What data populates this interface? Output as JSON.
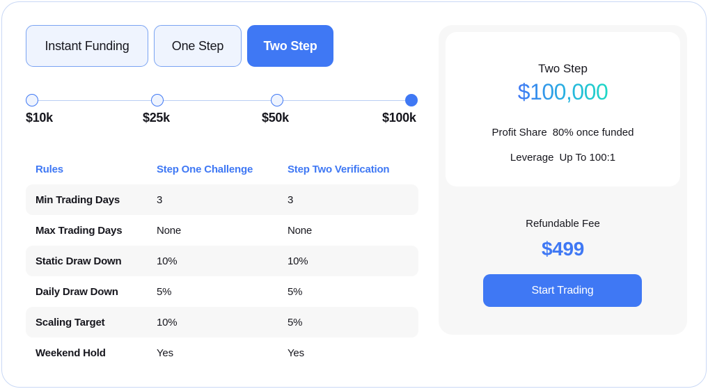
{
  "tabs": [
    {
      "label": "Instant Funding",
      "active": false
    },
    {
      "label": "One Step",
      "active": false
    },
    {
      "label": "Two Step",
      "active": true
    }
  ],
  "account_sizes": {
    "options": [
      "$10k",
      "$25k",
      "$50k",
      "$100k"
    ],
    "selected_index": 3
  },
  "rules_table": {
    "headers": [
      "Rules",
      "Step One Challenge",
      "Step Two Verification"
    ],
    "rows": [
      [
        "Min Trading Days",
        "3",
        "3"
      ],
      [
        "Max Trading Days",
        "None",
        "None"
      ],
      [
        "Static Draw Down",
        "10%",
        "10%"
      ],
      [
        "Daily Draw Down",
        "5%",
        "5%"
      ],
      [
        "Scaling Target",
        "10%",
        "5%"
      ],
      [
        "Weekend Hold",
        "Yes",
        "Yes"
      ]
    ]
  },
  "summary": {
    "plan_name": "Two Step",
    "account_amount": "$100,000",
    "profit_share_label": "Profit Share",
    "profit_share_value": "80% once funded",
    "leverage_label": "Leverage",
    "leverage_value": "Up To 100:1",
    "fee_label": "Refundable Fee",
    "fee_amount": "$499",
    "cta_label": "Start Trading"
  },
  "colors": {
    "accent": "#3f78f4",
    "gradient_start": "#3f78f4",
    "gradient_end": "#1fd8c5",
    "row_shade": "#f7f7f7"
  }
}
